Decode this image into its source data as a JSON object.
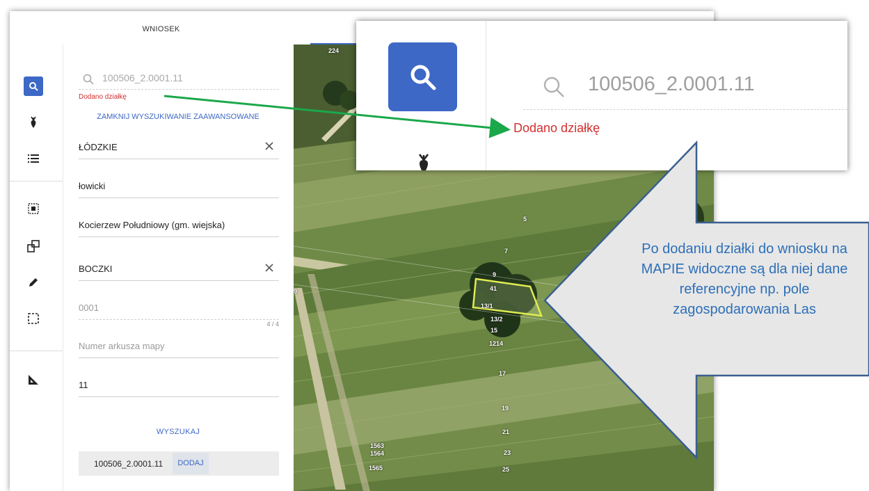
{
  "topbar": {
    "tab_label": "WNIOSEK"
  },
  "search": {
    "query": "100506_2.0001.11",
    "status_message": "Dodano działkę",
    "advanced_link": "ZAMKNIJ WYSZUKIWANIE ZAAWANSOWANE"
  },
  "fields": {
    "voivodeship": "ŁÓDZKIE",
    "county": "łowicki",
    "commune": "Kocierzew Południowy (gm. wiejska)",
    "precinct": "BOCZKI",
    "precinct_number_placeholder": "0001",
    "counter": "4 / 4",
    "map_sheet_placeholder": "Numer arkusza mapy",
    "parcel_number": "11"
  },
  "actions": {
    "search_label": "WYSZUKAJ",
    "add_label": "DODAJ"
  },
  "result": {
    "parcel_id": "100506_2.0001.11"
  },
  "map": {
    "labels": [
      "224",
      "5",
      "7",
      "9",
      "41",
      "13/1",
      "13/2",
      "15",
      "1214",
      "17",
      "19",
      "21",
      "23",
      "25",
      "1563",
      "1564",
      "1565",
      "9"
    ]
  },
  "zoom_inset": {
    "query": "100506_2.0001.11",
    "status_message": "Dodano działkę"
  },
  "callout": {
    "text": "Po dodaniu działki do wniosku na MAPIE widoczne są dla niej dane referencyjne np. pole zagospodarowania Las"
  },
  "colors": {
    "accent": "#3d68c6",
    "error": "#d32f2f",
    "arrow": "#1aa84a",
    "callout_text": "#2d6fb8"
  }
}
